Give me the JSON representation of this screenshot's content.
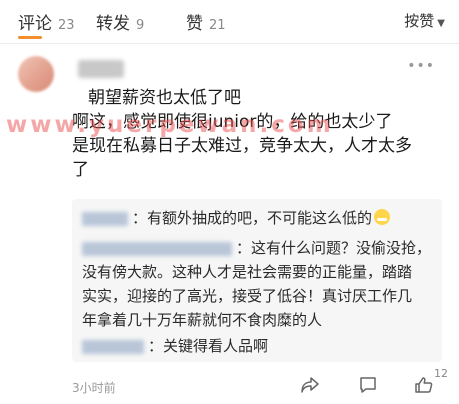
{
  "tabs": [
    {
      "label": "评论",
      "count": "23"
    },
    {
      "label": "转发",
      "count": "9"
    },
    {
      "label": "赞",
      "count": "21"
    }
  ],
  "sort": {
    "label": "按赞"
  },
  "comment": {
    "lines": [
      "朝望薪资也太低了吧",
      "啊这，感觉即使很junior的，给的也太少了",
      "是现在私募日子太难过，竞争太大，人才太多",
      "了"
    ]
  },
  "watermark": "www.yuerpewan.com",
  "replies": [
    {
      "text": "有额外抽成的吧，不可能这么低的"
    },
    {
      "lines": [
        "这有什么问题？没偷没抢，",
        "没有傍大款。这种人才是社会需要的正能量，踏踏",
        "实实，迎接的了高光，接受了低谷！真讨厌工作几",
        "年拿着几十万年薪就何不食肉糜的人"
      ]
    },
    {
      "text": "关键得看人品啊"
    }
  ],
  "footer": {
    "time": "3小时前",
    "like_count": "12"
  },
  "colors": {
    "accent": "#f08f2b",
    "reply_bg": "#f6f6f6",
    "watermark": "#eb5050"
  }
}
